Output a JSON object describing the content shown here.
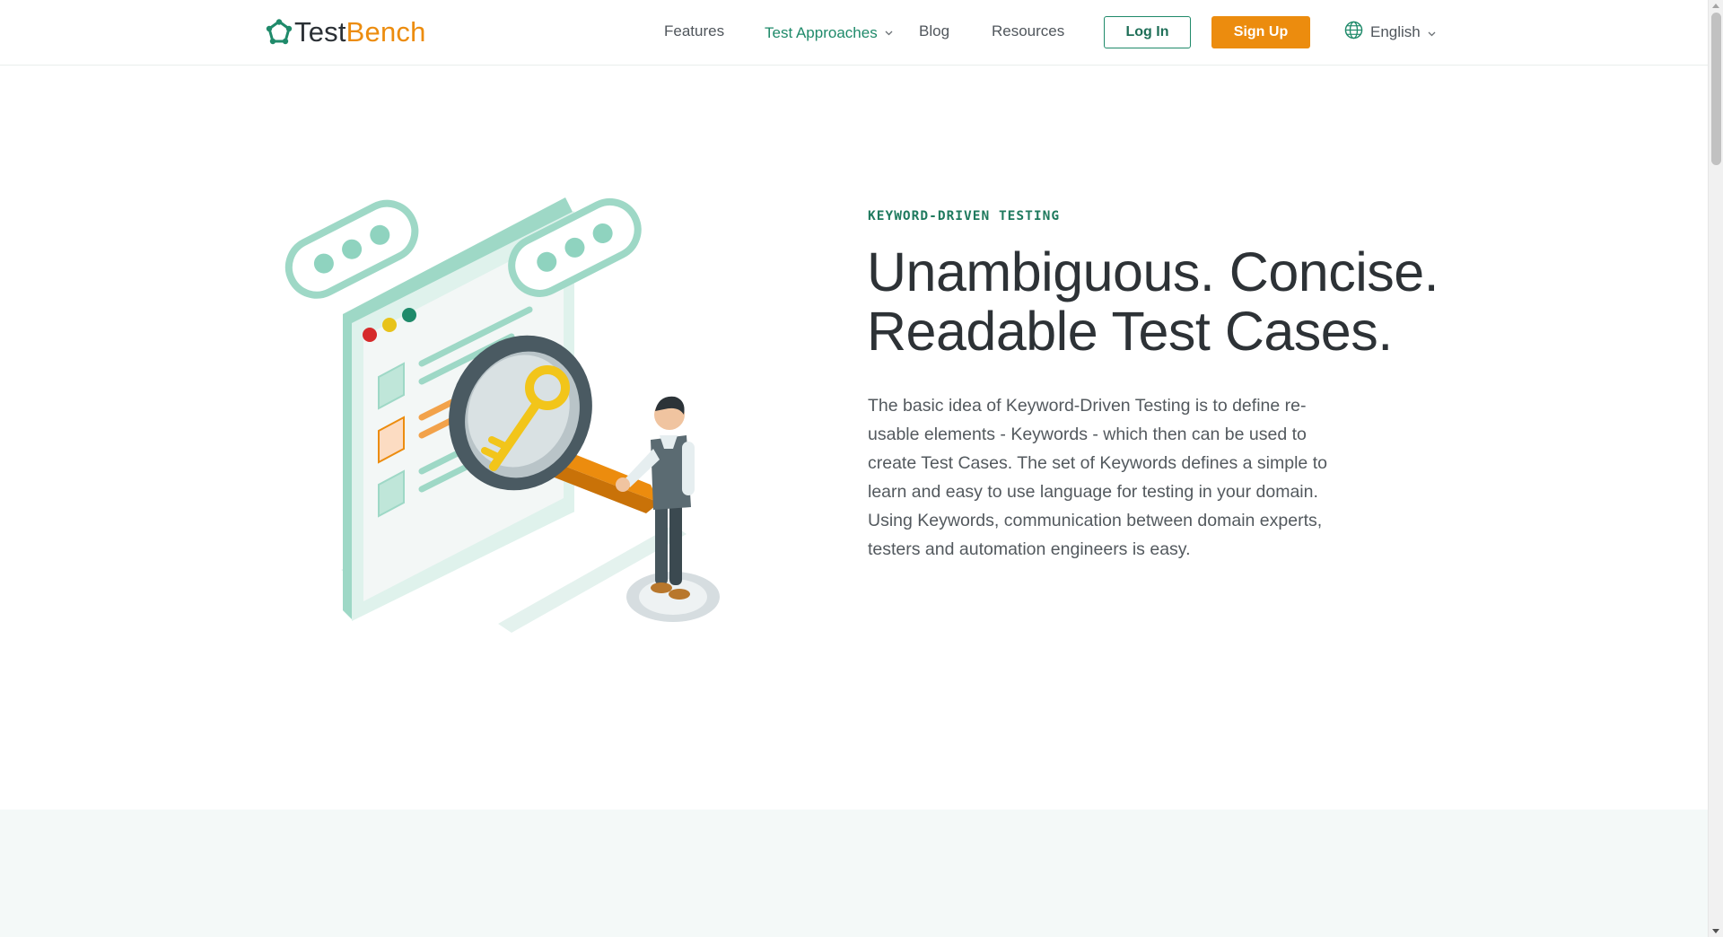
{
  "brand": {
    "logo_part1": "Test",
    "logo_part2": "Bench"
  },
  "nav": {
    "features": "Features",
    "test_approaches": "Test Approaches",
    "blog": "Blog",
    "resources": "Resources"
  },
  "auth": {
    "login_label": "Log In",
    "signup_label": "Sign Up"
  },
  "language": {
    "selected": "English"
  },
  "hero": {
    "eyebrow": "KEYWORD-DRIVEN TESTING",
    "headline_line1": "Unambiguous. Concise.",
    "headline_line2": "Readable Test Cases.",
    "body": "The basic idea of Keyword-Driven Testing is to define re-usable elements - Keywords - which then can be used to create Test Cases. The set of Keywords defines a simple to learn and easy to use language for testing in your domain. Using Keywords, communication between domain experts, testers and automation engineers is easy."
  },
  "colors": {
    "brand_green": "#1f8a6a",
    "brand_orange": "#ec8c0e",
    "mint": "#8fd3bf",
    "band_bg": "#f4f9f8"
  },
  "icons": {
    "logo": "testbench-logo-icon",
    "language": "globe-icon",
    "dropdown": "chevron-down-icon",
    "illustration": "keyword-search-illustration"
  }
}
